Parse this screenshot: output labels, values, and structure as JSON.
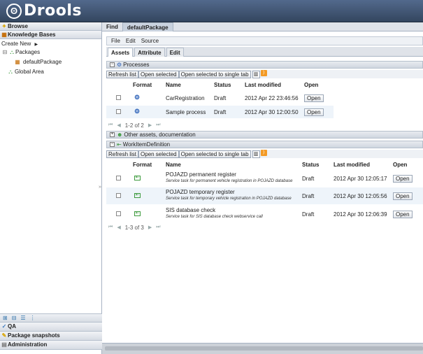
{
  "app": {
    "logo_text": "Drools"
  },
  "left": {
    "browse": "Browse",
    "knowledge_bases": "Knowledge Bases",
    "create_new": "Create New",
    "packages": "Packages",
    "default_package": "defaultPackage",
    "global_area": "Global Area",
    "qa": "QA",
    "package_snapshots": "Package snapshots",
    "administration": "Administration"
  },
  "tabs": {
    "find": "Find",
    "default_package": "defaultPackage"
  },
  "menu": {
    "file": "File",
    "edit": "Edit",
    "source": "Source"
  },
  "subtabs": {
    "assets": "Assets",
    "attribute": "Attribute",
    "edit": "Edit"
  },
  "processes": {
    "title": "Processes",
    "toolbar": {
      "refresh": "Refresh list",
      "open_selected": "Open selected",
      "open_single": "Open selected to single tab"
    },
    "columns": {
      "format": "Format",
      "name": "Name",
      "status": "Status",
      "last_modified": "Last modified",
      "open": "Open"
    },
    "rows": [
      {
        "name": "CarRegistration",
        "status": "Draft",
        "modified": "2012 Apr 22 23:46:56",
        "open": "Open"
      },
      {
        "name": "Sample process",
        "status": "Draft",
        "modified": "2012 Apr 30 12:00:50",
        "open": "Open"
      }
    ],
    "pager": "1-2 of 2"
  },
  "other_assets": "Other assets, documentation",
  "workitem": {
    "title": "WorkItemDefinition",
    "toolbar": {
      "refresh": "Refresh list",
      "open_selected": "Open selected",
      "open_single": "Open selected to single tab"
    },
    "columns": {
      "format": "Format",
      "name": "Name",
      "status": "Status",
      "last_modified": "Last modified",
      "open": "Open"
    },
    "rows": [
      {
        "name": "POJAZD permanent register",
        "desc": "Service task for permanent vehicle registration in POJAZD database",
        "status": "Draft",
        "modified": "2012 Apr 30 12:05:17",
        "open": "Open"
      },
      {
        "name": "POJAZD temporary register",
        "desc": "Service task for temporary vehicle registration in POJAZD database",
        "status": "Draft",
        "modified": "2012 Apr 30 12:05:56",
        "open": "Open"
      },
      {
        "name": "SIS database check",
        "desc": "Service task for SIS database check webservice call",
        "status": "Draft",
        "modified": "2012 Apr 30 12:06:39",
        "open": "Open"
      }
    ],
    "pager": "1-3 of 3"
  }
}
